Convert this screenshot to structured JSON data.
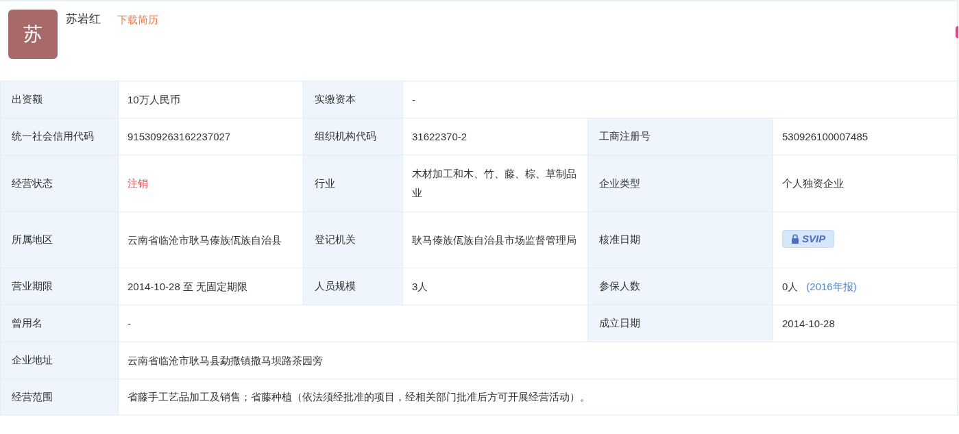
{
  "person": {
    "avatar_char": "苏",
    "name": "苏岩红",
    "download_link": "下载简历"
  },
  "rows": [
    [
      {
        "label": "出资额",
        "value": "10万人民币",
        "kind": "text"
      },
      {
        "label": "实缴资本",
        "value": "-",
        "kind": "text"
      }
    ],
    [
      {
        "label": "统一社会信用代码",
        "value": "915309263162237027",
        "kind": "text"
      },
      {
        "label": "组织机构代码",
        "value": "31622370-2",
        "kind": "text"
      },
      {
        "label": "工商注册号",
        "value": "530926100007485",
        "kind": "text"
      }
    ],
    [
      {
        "label": "经营状态",
        "value": "注销",
        "kind": "status"
      },
      {
        "label": "行业",
        "value": "木材加工和木、竹、藤、棕、草制品业",
        "kind": "text"
      },
      {
        "label": "企业类型",
        "value": "个人独资企业",
        "kind": "text"
      }
    ],
    [
      {
        "label": "所属地区",
        "value": "云南省临沧市耿马傣族佤族自治县",
        "kind": "text"
      },
      {
        "label": "登记机关",
        "value": "耿马傣族佤族自治县市场监督管理局",
        "kind": "text"
      },
      {
        "label": "核准日期",
        "value": "SVIP",
        "kind": "locked"
      }
    ],
    [
      {
        "label": "营业期限",
        "value": "2014-10-28 至 无固定期限",
        "kind": "text"
      },
      {
        "label": "人员规模",
        "value": "3人",
        "kind": "text"
      },
      {
        "label": "参保人数",
        "value": "0人",
        "note": "(2016年报)",
        "kind": "text"
      }
    ],
    [
      {
        "label": "曾用名",
        "value": "-",
        "kind": "text"
      },
      {
        "label": "成立日期",
        "value": "2014-10-28",
        "kind": "text"
      }
    ],
    [
      {
        "label": "企业地址",
        "value": "云南省临沧市耿马县勐撒镇撒马坝路茶园旁",
        "kind": "text"
      }
    ],
    [
      {
        "label": "经营范围",
        "value": "省藤手工艺品加工及销售；省藤种植（依法须经批准的项目，经相关部门批准后方可开展经营活动）。",
        "kind": "text"
      }
    ]
  ]
}
